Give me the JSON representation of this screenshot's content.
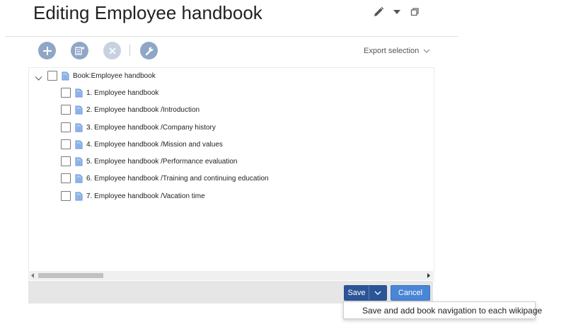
{
  "header": {
    "title": "Editing Employee handbook",
    "edit_icon": "pencil-icon",
    "menu_icon": "caret-down-icon",
    "maximize_icon": "maximize-icon"
  },
  "toolbar": {
    "buttons": [
      {
        "name": "add-icon",
        "enabled": true
      },
      {
        "name": "add-page-icon",
        "enabled": true
      },
      {
        "name": "remove-icon",
        "enabled": false
      },
      {
        "name": "wrench-icon",
        "enabled": true
      }
    ],
    "export_label": "Export selection"
  },
  "tree": {
    "root_label": "Book:Employee handbook",
    "items": [
      "1. Employee handbook",
      "2. Employee handbook /Introduction",
      "3. Employee handbook /Company history",
      "4. Employee handbook /Mission and values",
      "5. Employee handbook /Performance evaluation",
      "6. Employee handbook /Training and continuing education",
      "7. Employee handbook /Vacation time"
    ]
  },
  "footer": {
    "save_label": "Save",
    "cancel_label": "Cancel",
    "dropdown_item": "Save and add book navigation to each wikipage"
  },
  "colors": {
    "toolbar_button": "#8fa6c6",
    "toolbar_button_disabled": "#c7d1df",
    "save_button": "#2c5597",
    "cancel_button": "#4a86d6",
    "doc_icon": "#5b8fd6"
  }
}
